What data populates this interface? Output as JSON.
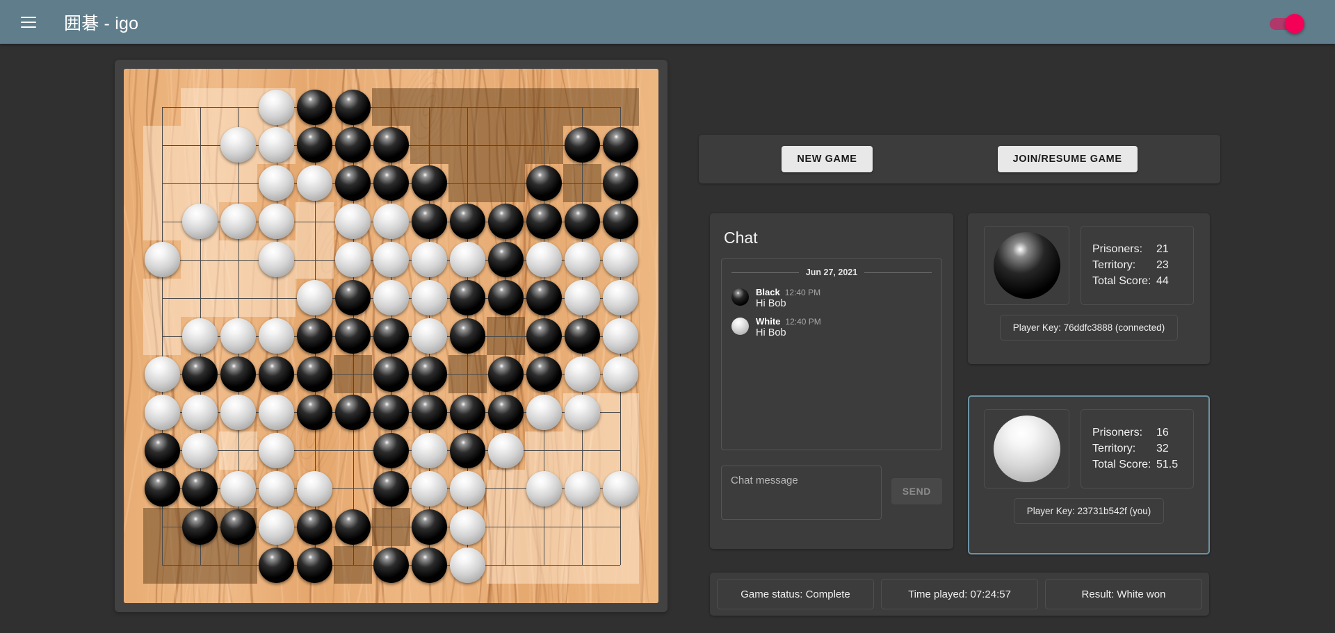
{
  "appbar": {
    "menu_icon": "hamburger-menu-icon",
    "title": "囲碁 - igo",
    "toggle_state": "on",
    "toggle_color": "#f50057"
  },
  "actions": {
    "new_game_label": "NEW GAME",
    "join_resume_label": "JOIN/RESUME GAME"
  },
  "chat": {
    "title": "Chat",
    "date_divider": "Jun 27, 2021",
    "messages": [
      {
        "author": "Black",
        "time": "12:40 PM",
        "text": "Hi Bob",
        "stone": "black"
      },
      {
        "author": "White",
        "time": "12:40 PM",
        "text": "Hi Bob",
        "stone": "white"
      }
    ],
    "input_placeholder": "Chat message",
    "input_value": "",
    "send_label": "SEND"
  },
  "players": [
    {
      "stone": "black",
      "labels": {
        "prisoners": "Prisoners:",
        "territory": "Territory:",
        "total": "Total Score:"
      },
      "prisoners": "21",
      "territory": "23",
      "total_score": "44",
      "player_key": "Player Key: 76ddfc3888  (connected)",
      "active": false
    },
    {
      "stone": "white",
      "labels": {
        "prisoners": "Prisoners:",
        "territory": "Territory:",
        "total": "Total Score:"
      },
      "prisoners": "16",
      "territory": "32",
      "total_score": "51.5",
      "player_key": "Player Key: 23731b542f  (you)",
      "active": true,
      "active_border_color": "#6d93a3"
    }
  ],
  "status": {
    "game_status": "Game status: Complete",
    "time_played": "Time played: 07:24:57",
    "result": "Result: White won"
  },
  "board": {
    "size": 13,
    "frame_color": "#424242",
    "wood_color": "#e8ae76",
    "line_color": "#4a4a4a",
    "hoshi": [
      [
        3,
        3
      ],
      [
        9,
        3
      ],
      [
        6,
        6
      ],
      [
        3,
        9
      ],
      [
        9,
        9
      ]
    ],
    "stones": [
      [
        null,
        null,
        null,
        "W",
        "B",
        "B",
        null,
        null,
        null,
        null,
        null,
        null,
        null
      ],
      [
        null,
        null,
        "W",
        "W",
        "B",
        "B",
        "B",
        null,
        null,
        null,
        null,
        "B",
        "B"
      ],
      [
        null,
        null,
        null,
        "W",
        "W",
        "B",
        "B",
        "B",
        null,
        null,
        "B",
        null,
        "B"
      ],
      [
        null,
        "W",
        "W",
        "W",
        null,
        "W",
        "W",
        "B",
        "B",
        "B",
        "B",
        "B",
        "B"
      ],
      [
        "W",
        null,
        null,
        "W",
        null,
        "W",
        "W",
        "W",
        "W",
        "B",
        "W",
        "W",
        "W"
      ],
      [
        null,
        null,
        null,
        null,
        "W",
        "B",
        "W",
        "W",
        "B",
        "B",
        "B",
        "W",
        "W"
      ],
      [
        null,
        "W",
        "W",
        "W",
        "B",
        "B",
        "B",
        "W",
        "B",
        null,
        "B",
        "B",
        "W"
      ],
      [
        "W",
        "B",
        "B",
        "B",
        "B",
        null,
        "B",
        "B",
        null,
        "B",
        "B",
        "W",
        "W"
      ],
      [
        "W",
        "W",
        "W",
        "W",
        "B",
        "B",
        "B",
        "B",
        "B",
        "B",
        "W",
        "W",
        null
      ],
      [
        "B",
        "W",
        null,
        "W",
        null,
        null,
        "B",
        "W",
        "B",
        "W",
        null,
        null,
        null
      ],
      [
        "B",
        "B",
        "W",
        "W",
        "W",
        null,
        "B",
        "W",
        "W",
        null,
        "W",
        "W",
        "W"
      ],
      [
        null,
        "B",
        "B",
        "W",
        "B",
        "B",
        null,
        "B",
        "W",
        null,
        null,
        null,
        null
      ],
      [
        null,
        null,
        null,
        "B",
        "B",
        null,
        "B",
        "B",
        "W",
        null,
        null,
        null,
        null
      ]
    ],
    "territory": [
      [
        null,
        "W",
        "W",
        "W",
        null,
        null,
        "B",
        "B",
        "B",
        "B",
        "B",
        "B",
        "B"
      ],
      [
        "W",
        "W",
        "W",
        "W",
        null,
        null,
        null,
        "B",
        "B",
        "B",
        "B",
        null,
        null
      ],
      [
        "W",
        "W",
        "W",
        null,
        null,
        null,
        null,
        null,
        "B",
        "B",
        null,
        "B",
        null
      ],
      [
        "W",
        "W",
        null,
        null,
        "W",
        null,
        null,
        null,
        null,
        null,
        null,
        null,
        null
      ],
      [
        null,
        "W",
        "W",
        "W",
        "W",
        null,
        null,
        null,
        null,
        null,
        null,
        null,
        null
      ],
      [
        "W",
        "W",
        "W",
        "W",
        null,
        null,
        null,
        null,
        null,
        null,
        null,
        null,
        null
      ],
      [
        "W",
        null,
        null,
        null,
        null,
        null,
        null,
        null,
        null,
        "B",
        null,
        null,
        null
      ],
      [
        null,
        null,
        null,
        null,
        null,
        "B",
        null,
        null,
        "B",
        null,
        null,
        null,
        null
      ],
      [
        null,
        null,
        null,
        null,
        null,
        null,
        null,
        null,
        null,
        null,
        null,
        "W",
        "W"
      ],
      [
        null,
        null,
        "W",
        null,
        null,
        null,
        null,
        null,
        null,
        null,
        "W",
        "W",
        "W"
      ],
      [
        null,
        null,
        null,
        null,
        null,
        null,
        null,
        null,
        null,
        "W",
        "W",
        "W",
        "W"
      ],
      [
        "B",
        "B",
        "B",
        null,
        null,
        null,
        "B",
        null,
        null,
        "W",
        "W",
        "W",
        "W"
      ],
      [
        "B",
        "B",
        "B",
        null,
        null,
        "B",
        null,
        null,
        null,
        "W",
        "W",
        "W",
        "W"
      ]
    ]
  }
}
